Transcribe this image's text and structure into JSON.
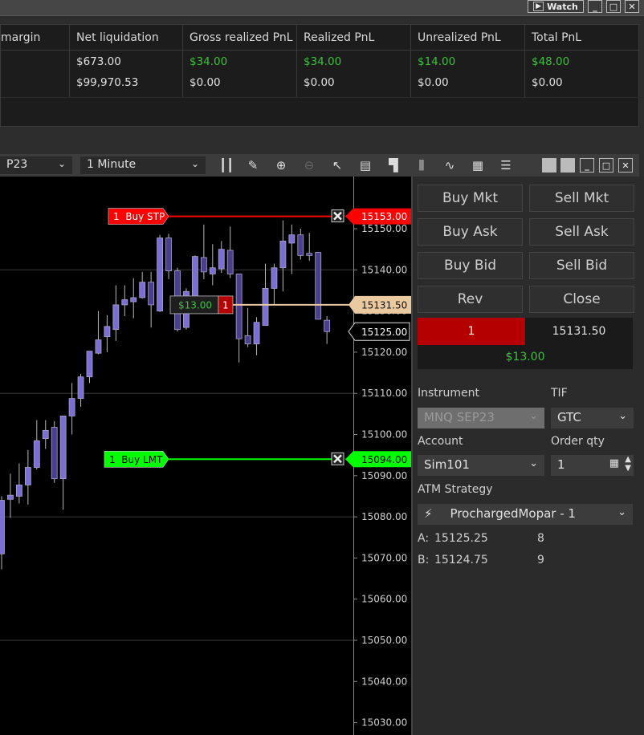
{
  "window": {
    "watch_label": "Watch",
    "minimize": "_",
    "maximize": "□",
    "close": "✕"
  },
  "account_grid": {
    "columns": [
      "margin",
      "Net liquidation",
      "Gross realized PnL",
      "Realized PnL",
      "Unrealized PnL",
      "Total PnL"
    ],
    "rows": [
      [
        "",
        "$673.00",
        "$34.00",
        "$34.00",
        "$14.00",
        "$48.00"
      ],
      [
        "",
        "$99,970.53",
        "$0.00",
        "$0.00",
        "$0.00",
        "$0.00"
      ]
    ],
    "positive_color": "#3fbf3f"
  },
  "chart_toolbar": {
    "instrument": "P23",
    "interval": "1 Minute",
    "icons": [
      "bars-type-icon",
      "drawing-pencil-icon",
      "zoom-in-icon",
      "zoom-out-icon",
      "pointer-icon",
      "data-box-icon",
      "chart-trader-icon",
      "bar-spacing-icon",
      "strategies-icon",
      "indicators-icon",
      "properties-icon"
    ]
  },
  "chart_data": {
    "type": "candlestick",
    "ylim": [
      15027,
      15163
    ],
    "y_ticks": [
      "15150.00",
      "15140.00",
      "15130.00",
      "15120.00",
      "15110.00",
      "15100.00",
      "15090.00",
      "15080.00",
      "15070.00",
      "15060.00",
      "15050.00",
      "15040.00",
      "15030.00"
    ],
    "up_color": "#7b6fd2",
    "down_color": "#4a3f8c",
    "candles": [
      [
        15071,
        15085,
        15067.25,
        15084
      ],
      [
        15084.25,
        15090.5,
        15079.75,
        15085.25
      ],
      [
        15085,
        15093,
        15083.25,
        15087.75
      ],
      [
        15087.75,
        15096.25,
        15083,
        15092
      ],
      [
        15092,
        15103.5,
        15091.5,
        15098.5
      ],
      [
        15099,
        15103.5,
        15096.5,
        15101
      ],
      [
        15101.75,
        15103.25,
        15088.25,
        15089.25
      ],
      [
        15089.25,
        15104.5,
        15081.75,
        15104.5
      ],
      [
        15104.5,
        15112.5,
        15100,
        15108.75
      ],
      [
        15108.75,
        15114.75,
        15106.75,
        15114
      ],
      [
        15114,
        15120.25,
        15112.5,
        15120.25
      ],
      [
        15119.75,
        15130,
        15119.5,
        15123
      ],
      [
        15123.75,
        15129,
        15120,
        15126.25
      ],
      [
        15125.5,
        15136.25,
        15122.75,
        15131.5
      ],
      [
        15131.5,
        15136.25,
        15128.75,
        15132.75
      ],
      [
        15132.25,
        15138,
        15128.25,
        15133.25
      ],
      [
        15133.25,
        15139.5,
        15133,
        15137
      ],
      [
        15137,
        15139.5,
        15126,
        15131.5
      ],
      [
        15130,
        15148.5,
        15129.75,
        15147.75
      ],
      [
        15147.75,
        15148.75,
        15137.75,
        15139.75
      ],
      [
        15139.75,
        15140.5,
        15125,
        15125.5
      ],
      [
        15126,
        15135.5,
        15125.5,
        15134.75
      ],
      [
        15132.5,
        15143.5,
        15131.5,
        15143.25
      ],
      [
        15143,
        15151,
        15137.75,
        15139.5
      ],
      [
        15139,
        15146.25,
        15136.25,
        15140.5
      ],
      [
        15140.25,
        15147,
        15139.25,
        15145
      ],
      [
        15144.75,
        15150.5,
        15138,
        15139
      ],
      [
        15139,
        15139,
        15117.5,
        15123.25
      ],
      [
        15124,
        15130.75,
        15121.25,
        15122
      ],
      [
        15122,
        15128.5,
        15119.25,
        15127.25
      ],
      [
        15126.5,
        15141.5,
        15126.5,
        15135.5
      ],
      [
        15135.5,
        15141.5,
        15131.5,
        15140.5
      ],
      [
        15140.5,
        15152,
        15134.75,
        15147
      ],
      [
        15146.5,
        15151,
        15139,
        15148.5
      ],
      [
        15148.5,
        15150,
        15142.5,
        15143.5
      ],
      [
        15144,
        15149,
        15142.25,
        15143.5
      ],
      [
        15144.25,
        15144.25,
        15128,
        15128
      ],
      [
        15127.75,
        15128.75,
        15122,
        15125
      ]
    ],
    "orders": [
      {
        "label": "1  Buy STP",
        "price": 15153.0,
        "price_label": "15153.00",
        "color": "#ff0000"
      },
      {
        "label": "1  Buy LMT",
        "price": 15094.0,
        "price_label": "15094.00",
        "color": "#00ff00"
      }
    ],
    "position": {
      "pnl": "$13.00",
      "qty": "1",
      "price": 15131.5,
      "price_label": "15131.50",
      "color": "#e8c9a0"
    },
    "last_price": {
      "price": 15125.0,
      "label": "15125.00"
    }
  },
  "chart_trader": {
    "buttons": [
      "Buy Mkt",
      "Sell Mkt",
      "Buy Ask",
      "Sell Ask",
      "Buy Bid",
      "Sell Bid",
      "Rev",
      "Close"
    ],
    "position_qty": "1",
    "position_price": "15131.50",
    "position_pnl": "$13.00",
    "instrument_label": "Instrument",
    "instrument": "MNQ SEP23",
    "tif_label": "TIF",
    "tif": "GTC",
    "account_label": "Account",
    "account": "Sim101",
    "qty_label": "Order qty",
    "qty": "1",
    "atm_label": "ATM Strategy",
    "atm": "ProchargedMopar - 1",
    "ask_label": "A:",
    "ask": "15125.25",
    "ask_size": "8",
    "bid_label": "B:",
    "bid": "15124.75",
    "bid_size": "9"
  }
}
